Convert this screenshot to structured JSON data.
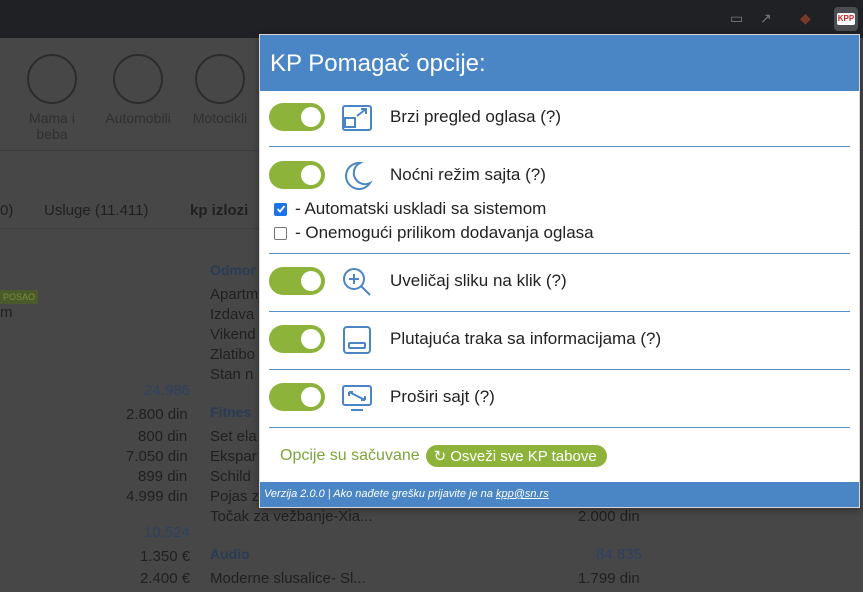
{
  "popup": {
    "title": "KP Pomagač opcije:",
    "options": [
      {
        "label": "Brzi pregled oglasa (?)",
        "enabled": true,
        "icon": "quick-view-icon"
      },
      {
        "label": "Noćni režim sajta (?)",
        "enabled": true,
        "icon": "moon-icon"
      },
      {
        "label": "Uveličaj sliku na klik (?)",
        "enabled": true,
        "icon": "zoom-in-icon"
      },
      {
        "label": "Plutajuća traka sa informacijama (?)",
        "enabled": true,
        "icon": "floating-bar-icon"
      },
      {
        "label": "Proširi sajt (?)",
        "enabled": true,
        "icon": "widen-site-icon"
      }
    ],
    "night_sub": [
      {
        "label": "- Automatski uskladi sa sistemom",
        "checked": true
      },
      {
        "label": "- Onemogući prilikom dodavanja oglasa",
        "checked": false
      }
    ],
    "saved_text": "Opcije su sačuvane",
    "refresh_button": "Osveži sve KP tabove",
    "footer_prefix": "Verzija 2.0.0 | Ako nađete grešku prijavite je na ",
    "footer_email": "kpp@sn.rs",
    "accent_color": "#4a86c5",
    "toggle_color": "#8db33a"
  },
  "background": {
    "categories": [
      {
        "label_line1": "Mama i",
        "label_line2": "beba"
      },
      {
        "label_line1": "Automobili",
        "label_line2": ""
      },
      {
        "label_line1": "Motocikli",
        "label_line2": ""
      }
    ],
    "tabs": [
      "0)",
      "Usluge (11.411)",
      "kp izlozi"
    ],
    "badge": "POSAO",
    "left_fragment": "m",
    "left_numbers": [
      "24.986",
      "2.800 din",
      "800 din",
      "7.050 din",
      "899 din",
      "4.999 din",
      "10.524",
      "1.350 €",
      "2.400 €"
    ],
    "col_headers": [
      "Odmor",
      "Fitnes",
      "Audio"
    ],
    "col_items": [
      "Apartm",
      "Izdava",
      "Vikend",
      "Zlatibo",
      "Stan n",
      "Set ela",
      "Ekspar",
      "Schild",
      "Pojas z",
      "Točak za vežbanje-Xia...",
      "Moderne slusalice- Sl..."
    ],
    "right_numbers": [
      "2.000 din",
      "84.835",
      "1.799 din"
    ]
  }
}
